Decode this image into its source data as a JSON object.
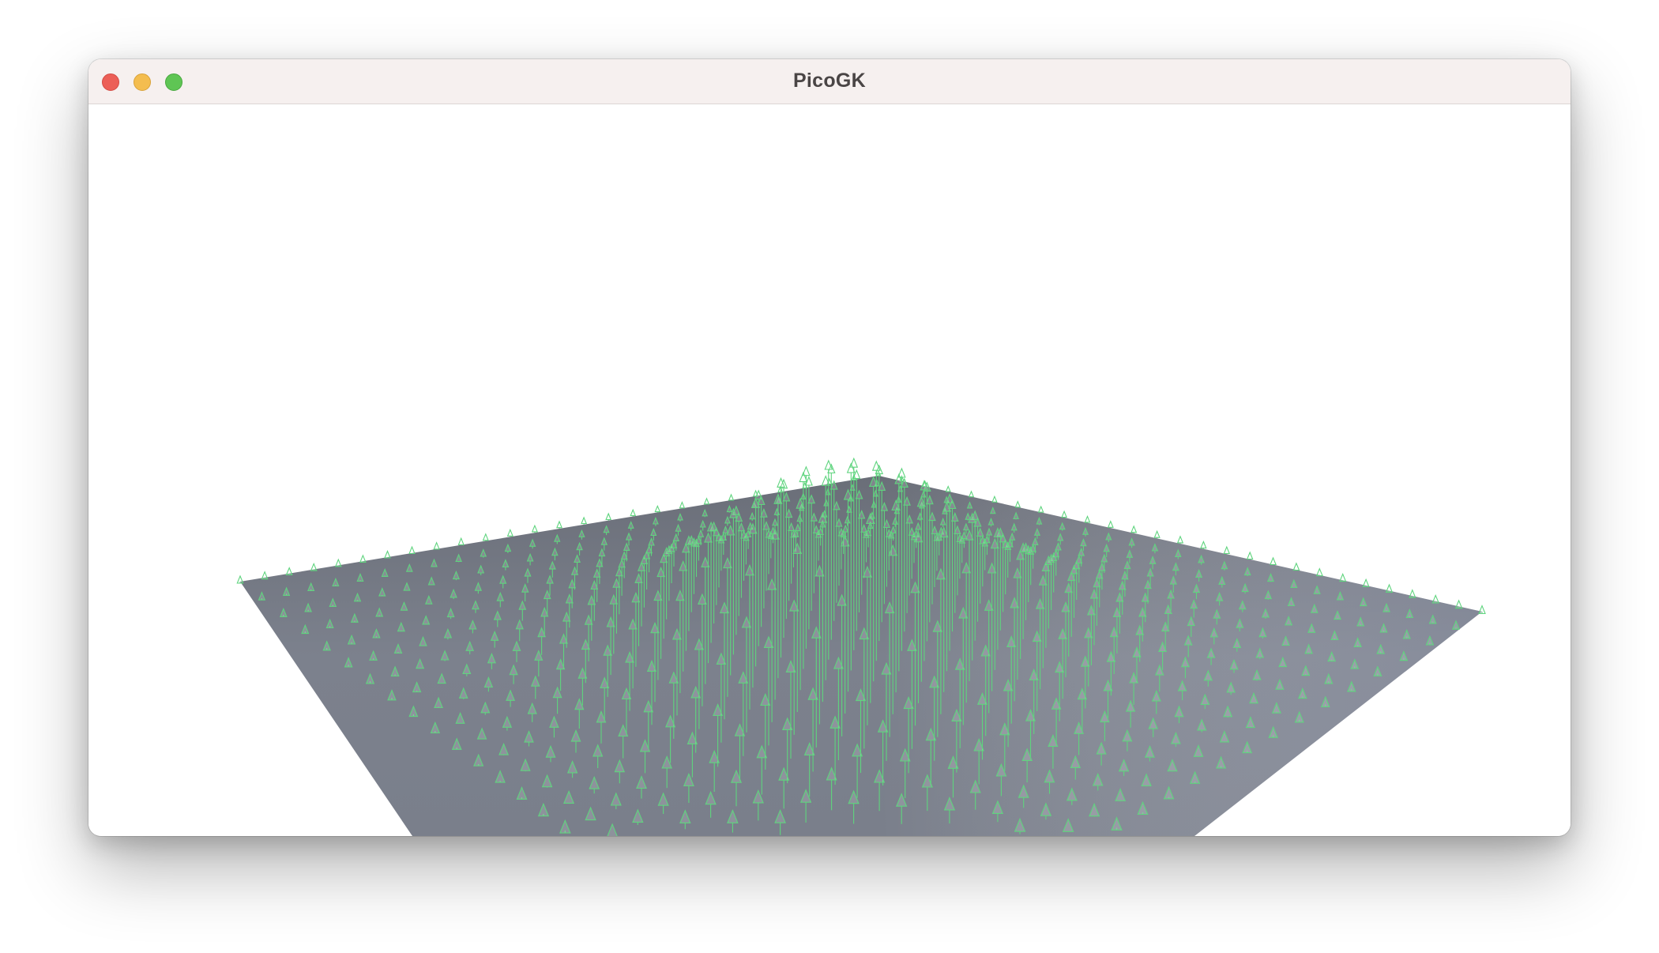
{
  "window": {
    "title": "PicoGK"
  },
  "colors": {
    "plane_light": "#8a8f9c",
    "plane_dark": "#6c707a",
    "arrow": "#5fd47e",
    "titlebar": "#f6f0ef",
    "close": "#ec5f57",
    "minimize": "#f4bd4f",
    "zoom": "#5fc554"
  },
  "icons": {
    "close": "close-icon",
    "minimize": "minimize-icon",
    "zoom": "zoom-icon"
  }
}
